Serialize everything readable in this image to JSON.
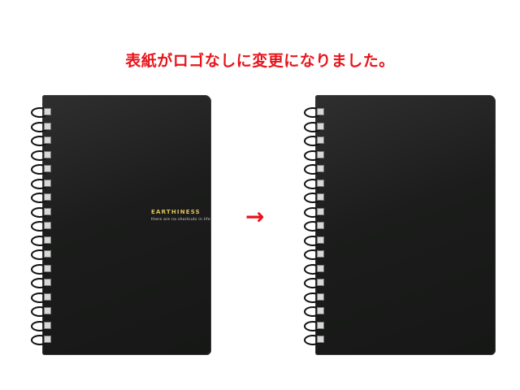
{
  "headline": "表紙がロゴなしに変更になりました。",
  "before": {
    "logo_title": "EARTHINESS",
    "logo_tagline": "there are no shortcuts in life"
  },
  "arrow": "→",
  "colors": {
    "headline": "#e8141b",
    "cover": "#1b1c1b",
    "logo": "#e2c45a"
  }
}
